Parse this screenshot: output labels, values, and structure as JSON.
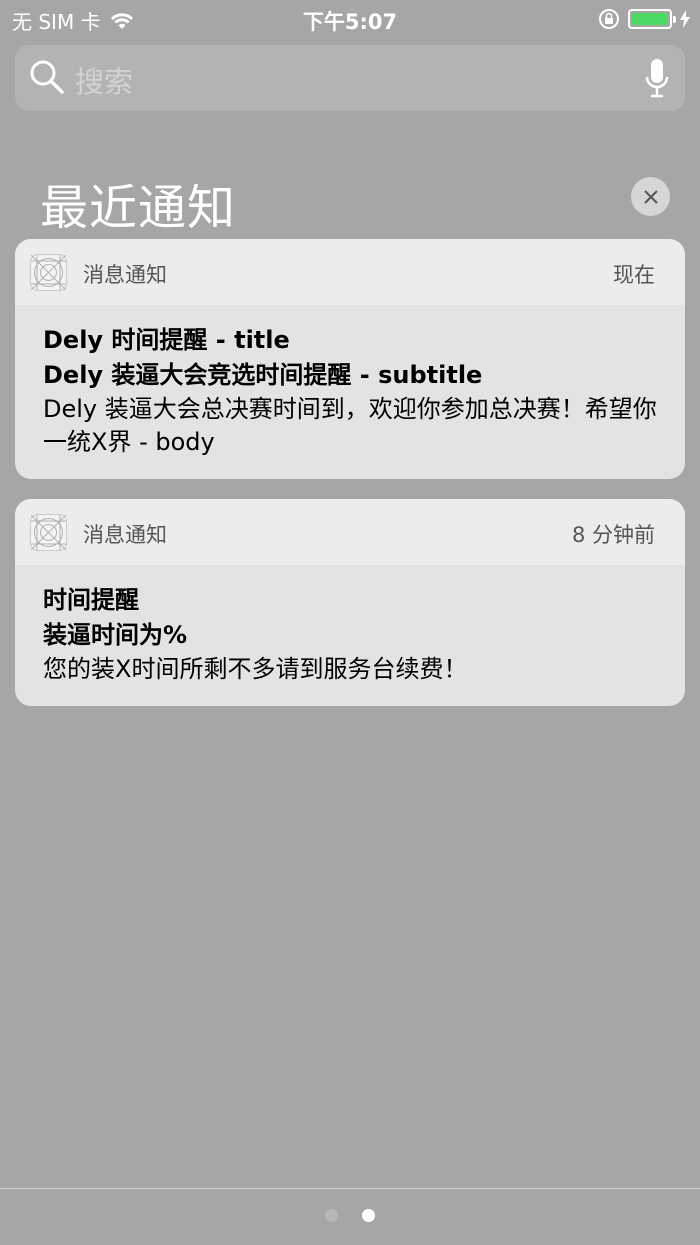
{
  "status_bar": {
    "carrier": "无 SIM 卡",
    "time": "下午5:07",
    "battery_level": 1.0,
    "icons": [
      "wifi-icon",
      "rotation-lock-icon",
      "battery-icon",
      "charging-icon"
    ]
  },
  "search": {
    "placeholder": "搜索",
    "icons": [
      "search-icon",
      "microphone-icon"
    ]
  },
  "section": {
    "title": "最近通知",
    "clear_icon": "close-icon"
  },
  "notifications": [
    {
      "app_name": "消息通知",
      "time": "现在",
      "title": "Dely 时间提醒 - title",
      "subtitle": "Dely 装逼大会竞选时间提醒 - subtitle",
      "body": "Dely 装逼大会总决赛时间到，欢迎你参加总决赛！希望你一统X界 - body"
    },
    {
      "app_name": "消息通知",
      "time": "8 分钟前",
      "title": "时间提醒",
      "subtitle": "装逼时间为%",
      "body": "您的装X时间所剩不多请到服务台续费！"
    }
  ],
  "page_indicator": {
    "count": 2,
    "current": 2
  },
  "colors": {
    "battery": "#4cd964",
    "background": "#a6a6a6"
  }
}
